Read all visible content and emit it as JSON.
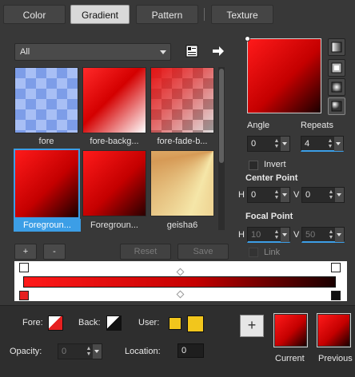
{
  "tabs": [
    {
      "label": "Color",
      "active": false
    },
    {
      "label": "Gradient",
      "active": true
    },
    {
      "label": "Pattern",
      "active": false
    },
    {
      "label": "Texture",
      "active": false
    }
  ],
  "filter": {
    "selected": "All"
  },
  "thumbnails": [
    {
      "label": "fore",
      "selected": false
    },
    {
      "label": "fore-backg...",
      "selected": false
    },
    {
      "label": "fore-fade-b...",
      "selected": false
    },
    {
      "label": "Foregroun...",
      "selected": true
    },
    {
      "label": "Foregroun...",
      "selected": false
    },
    {
      "label": "geisha6",
      "selected": false
    }
  ],
  "list_buttons": {
    "add": "+",
    "remove": "-",
    "reset": "Reset",
    "save": "Save"
  },
  "angle": {
    "label": "Angle",
    "value": "0"
  },
  "repeats": {
    "label": "Repeats",
    "value": "4"
  },
  "invert": {
    "label": "Invert",
    "checked": false
  },
  "center_point": {
    "label": "Center Point",
    "h_label": "H",
    "h_value": "0",
    "v_label": "V",
    "v_value": "0"
  },
  "focal_point": {
    "label": "Focal Point",
    "h_label": "H",
    "h_value": "10",
    "v_label": "V",
    "v_value": "50"
  },
  "link": {
    "label": "Link",
    "checked": false
  },
  "bottom": {
    "fore_label": "Fore:",
    "back_label": "Back:",
    "user_label": "User:",
    "opacity_label": "Opacity:",
    "opacity_value": "0",
    "location_label": "Location:",
    "location_value": "0",
    "current_label": "Current",
    "previous_label": "Previous",
    "add_symbol": "+"
  },
  "colors": {
    "gradient_start": "#ff1a1a",
    "gradient_mid": "#c40000",
    "gradient_end": "#1a0000",
    "accent": "#3c9ee6",
    "user_swatch_1": "#f2c61c",
    "user_swatch_2": "#f2c61c"
  },
  "icons": [
    "palette-icon",
    "arrow-right-icon",
    "linear-shape-icon",
    "rectangular-shape-icon",
    "sunburst-shape-icon",
    "radial-shape-icon"
  ]
}
